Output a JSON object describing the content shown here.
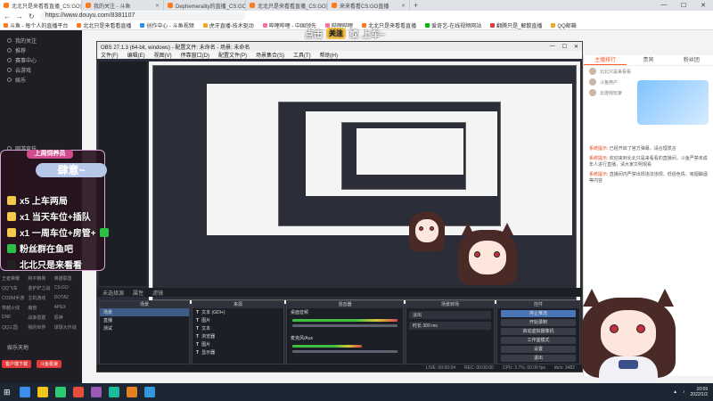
{
  "browser": {
    "tabs": [
      {
        "label": "北北只是来看看直播_CS:GO直播",
        "color": "#ff7a1a",
        "active": true
      },
      {
        "label": "我的关注 - 斗鱼",
        "color": "#ff7a1a",
        "active": false
      },
      {
        "label": "Dephemerality的直播_CS:GO直播",
        "color": "#ff7a1a",
        "active": false
      },
      {
        "label": "北北只是来看看直播_CS:GO直播",
        "color": "#ff7a1a",
        "active": false
      },
      {
        "label": "来来看看CS:GO直播",
        "color": "#ff7a1a",
        "active": false
      }
    ],
    "new_tab": "+",
    "window_controls": [
      "—",
      "☐",
      "✕"
    ],
    "url": "https://www.douyu.com/8381107",
    "bookmarks": [
      {
        "label": "斗鱼 - 每个人的直播平台",
        "color": "#ff7a1a"
      },
      {
        "label": "北北只是来看看直播",
        "color": "#ff7a1a"
      },
      {
        "label": "创作中心 - 斗鱼视频",
        "color": "#2d8cf0"
      },
      {
        "label": "虎牙直播-技术驱动",
        "color": "#f5a623"
      },
      {
        "label": "哔哩哔哩 - 中国领先",
        "color": "#fb7299"
      },
      {
        "label": "哔哩哔哩",
        "color": "#fb7299"
      },
      {
        "label": "北北只是来看看直播",
        "color": "#ff7a1a"
      },
      {
        "label": "爱奇艺-在线视频网站",
        "color": "#00be06"
      },
      {
        "label": "翻腾只是_解散直播",
        "color": "#e23a3a"
      },
      {
        "label": "QQ邮箱",
        "color": "#f5a623"
      }
    ]
  },
  "top_overlay": {
    "parts": [
      "点击",
      "关注",
      "或",
      "上车~"
    ]
  },
  "left_sidebar": {
    "items": [
      "我的关注",
      "推荐",
      "赛事中心",
      "云游戏",
      "娱乐",
      "网游竞技"
    ],
    "grid": [
      "王者荣耀",
      "和平精英",
      "英雄联盟",
      "QQ飞车",
      "金铲铲之战",
      "CS:GO",
      "CODM手游",
      "主机游戏",
      "DOTA2",
      "穿越火线",
      "魔兽",
      "APEX",
      "DNF",
      "战争雷霆",
      "原神",
      "QQ三国",
      "我的世界",
      "球球大作战"
    ],
    "section_label": "娱乐天地",
    "bottom_buttons": [
      "客户端下载",
      "斗鱼极速"
    ]
  },
  "bullet_card": {
    "title": "上周饲养员",
    "brand": "肆意~",
    "lines": [
      {
        "text": "x5 上车两局",
        "icon_color": "#f2c94c"
      },
      {
        "text": "x1 当天车位+插队",
        "icon_color": "#f2c94c"
      },
      {
        "text": "x1 一周车位+房管+",
        "icon_color": "#f2c94c"
      },
      {
        "text": "粉丝群在鱼吧",
        "icon_color": "#2dbf45"
      },
      {
        "text": "北北只是来看看",
        "icon_color": "#222222"
      }
    ]
  },
  "obs": {
    "title": "OBS 27.1.3 (64-bit, windows) - 配置文件: 未命名 - 场景: 未命名",
    "menu": [
      "文件(F)",
      "编辑(E)",
      "视图(V)",
      "停靠窗口(D)",
      "配置文件(P)",
      "场景集合(S)",
      "工具(T)",
      "帮助(H)"
    ],
    "canvas_bar": [
      "未选择源",
      "属性",
      "滤镜"
    ],
    "docks": {
      "scenes": {
        "header": "场景",
        "rows": [
          "场景",
          "直播",
          "测试"
        ]
      },
      "sources": {
        "header": "来源",
        "rows": [
          "文本 (GDI+)",
          "图片",
          "文本",
          "浏览器",
          "图片",
          "显示器"
        ]
      },
      "mixer": {
        "header": "混音器",
        "rows": [
          "桌面音频",
          "麦克风/Aux"
        ]
      },
      "transitions": {
        "header": "场景转场",
        "rows": [
          "淡出",
          "时长  300 ms"
        ]
      },
      "controls": {
        "header": "控件",
        "buttons": [
          "停止推流",
          "开始录制",
          "启动虚拟摄像机",
          "工作室模式",
          "设置",
          "退出"
        ]
      }
    },
    "status": [
      "LIVE: 00:00:04",
      "REC: 00:00:00",
      "CPU: 3.7%, 60.00 fps",
      "kb/s: 3482"
    ]
  },
  "right_panel": {
    "tabs": [
      "主播排行",
      "贵宾",
      "粉丝团"
    ],
    "users": [
      "北北只是来看看",
      "斗鱼用户",
      "云游戏玩家"
    ],
    "messages": [
      {
        "label": "系统提示:",
        "text": "已经开启了官方弹幕，请合理发言"
      },
      {
        "label": "系统提示:",
        "text": "欢迎来到北北只是来看看的直播间，斗鱼严禁未成年人进行直播，请大家文明观看"
      },
      {
        "label": "系统提示:",
        "text": "直播间内严禁出现违法违规、低俗色情、吸烟酗酒等内容"
      }
    ]
  },
  "taskbar": {
    "apps": [
      "#3b8eea",
      "#f0c419",
      "#2ecc71",
      "#e74c3c",
      "#9b59b6",
      "#1abc9c",
      "#e67e22",
      "#3498db"
    ],
    "time": "10:59",
    "date": "2022/1/2"
  }
}
